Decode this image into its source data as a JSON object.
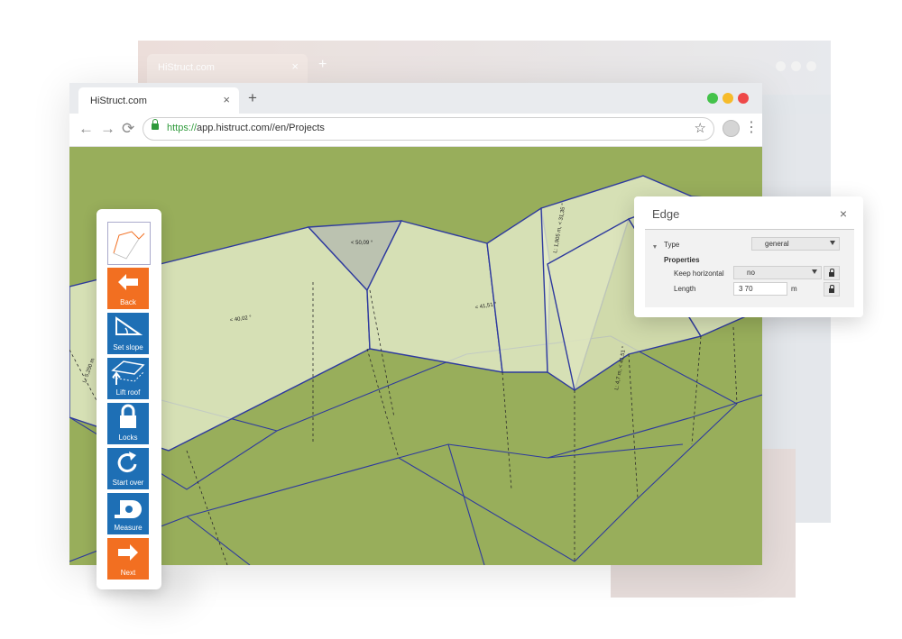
{
  "background_window": {
    "tab_title": "HiStruct.com",
    "close_glyph": "×",
    "new_tab_glyph": "+"
  },
  "browser": {
    "tab_title": "HiStruct.com",
    "close_glyph": "×",
    "new_tab_glyph": "+",
    "url_scheme": "https://",
    "url_rest": "app.histruct.com//en/Projects",
    "back_glyph": "←",
    "forward_glyph": "→",
    "reload_glyph": "⟳",
    "bookmark_glyph": "☆",
    "menu_glyph": "⋮",
    "traffic_colors": [
      "#44c24a",
      "#f6bb2a",
      "#ee4848"
    ]
  },
  "toolbar": {
    "items": [
      {
        "label": "Back",
        "icon": "arrow-left-icon",
        "color": "#f26f21"
      },
      {
        "label": "Set slope",
        "icon": "slope-icon",
        "color": "#1e6fb5"
      },
      {
        "label": "Lift roof",
        "icon": "lift-roof-icon",
        "color": "#1e6fb5"
      },
      {
        "label": "Locks",
        "icon": "lock-icon",
        "color": "#1e6fb5"
      },
      {
        "label": "Start over",
        "icon": "start-over-icon",
        "color": "#1e6fb5"
      },
      {
        "label": "Measure",
        "icon": "tape-measure-icon",
        "color": "#1e6fb5"
      },
      {
        "label": "Next",
        "icon": "arrow-right-icon",
        "color": "#f26f21"
      }
    ]
  },
  "model": {
    "ground_color": "#98ae5b",
    "roof_fill_color": "#e4ebc9",
    "edge_color": "#2e3a9e",
    "slope_labels": [
      "< 40,02 °",
      "< 50,09 °",
      "< 41,51 °"
    ],
    "dimension_labels": [
      "L: 5,250 m",
      "L: 1,905 m, < 31,35 °",
      "L: 4,7 m, < 41,51 °"
    ]
  },
  "edge_panel": {
    "title": "Edge",
    "close_glyph": "×",
    "type_label": "Type",
    "type_value": "general",
    "properties_label": "Properties",
    "keep_horizontal_label": "Keep horizontal",
    "keep_horizontal_value": "no",
    "length_label": "Length",
    "length_value": "3 70",
    "length_unit": "m"
  }
}
